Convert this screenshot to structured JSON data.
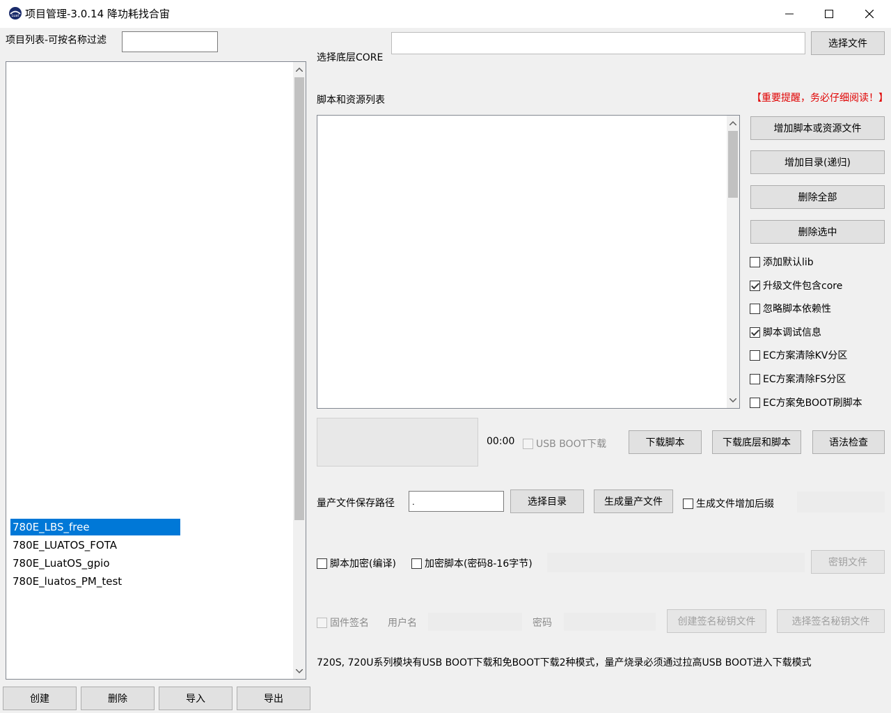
{
  "window": {
    "title": "项目管理-3.0.14 降功耗找合宙",
    "controls": [
      "minimize",
      "maximize",
      "close"
    ]
  },
  "left": {
    "filter_label": "项目列表-可按名称过滤",
    "filter_value": "",
    "projects": [
      "780E_LBS_free",
      "780E_LUATOS_FOTA",
      "780E_LuatOS_gpio",
      "780E_luatos_PM_test"
    ],
    "selected_index": 0,
    "buttons": {
      "create": "创建",
      "delete": "删除",
      "import": "导入",
      "export": "导出"
    }
  },
  "core": {
    "label": "选择底层CORE",
    "value": "",
    "button": "选择文件"
  },
  "scripts": {
    "label": "脚本和资源列表",
    "notice": "【重要提醒，务必仔细阅读！】",
    "buttons": {
      "add_file": "增加脚本或资源文件",
      "add_dir": "增加目录(递归)",
      "delete_all": "删除全部",
      "delete_selected": "删除选中"
    },
    "options": [
      {
        "label": "添加默认lib",
        "checked": false
      },
      {
        "label": "升级文件包含core",
        "checked": true
      },
      {
        "label": "忽略脚本依赖性",
        "checked": false
      },
      {
        "label": "脚本调试信息",
        "checked": true
      },
      {
        "label": "EC方案清除KV分区",
        "checked": false
      },
      {
        "label": "EC方案清除FS分区",
        "checked": false
      },
      {
        "label": "EC方案免BOOT刷脚本",
        "checked": false
      }
    ]
  },
  "download": {
    "timer": "00:00",
    "usb_boot_label": "USB BOOT下载",
    "usb_boot_checked": false,
    "btn_download_script": "下载脚本",
    "btn_download_core_script": "下载底层和脚本",
    "btn_syntax_check": "语法检查"
  },
  "mass_production": {
    "path_label": "量产文件保存路径",
    "path_value": ".",
    "btn_select_dir": "选择目录",
    "btn_generate": "生成量产文件",
    "suffix_label": "生成文件增加后缀",
    "suffix_checked": false,
    "suffix_value": ""
  },
  "encryption": {
    "encrypt_label": "脚本加密(编译)",
    "encrypt_checked": false,
    "encrypt_pwd_label": "加密脚本(密码8-16字节)",
    "encrypt_pwd_checked": false,
    "password_value": "",
    "key_file_button": "密钥文件"
  },
  "signing": {
    "sign_label": "固件签名",
    "sign_checked": false,
    "username_label": "用户名",
    "username_value": "",
    "password_label": "密码",
    "password_value": "",
    "btn_create_key": "创建签名秘钥文件",
    "btn_select_key": "选择签名秘钥文件"
  },
  "footer_note": "720S, 720U系列模块有USB BOOT下载和免BOOT下载2种模式，量产烧录必须通过拉高USB BOOT进入下载模式",
  "colors": {
    "selection": "#0078d7",
    "notice": "#e00000",
    "window_bg": "#f0f0f0"
  }
}
